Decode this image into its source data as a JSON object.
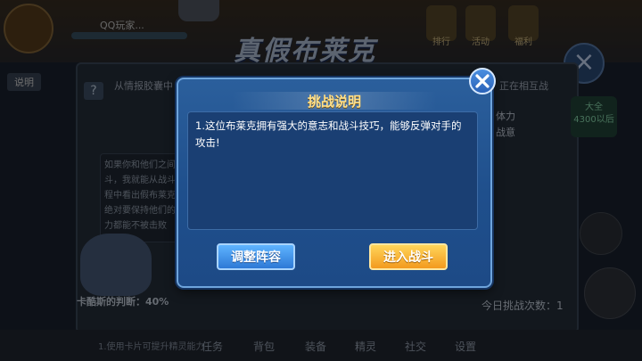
{
  "background": {
    "title": "真假布莱克",
    "player_name": "QQ玩家...",
    "tab_label": "说明",
    "info_text": "从情报胶囊中",
    "info_text_right": "正在相互战",
    "side_labels": [
      "体力",
      "战意"
    ],
    "stat_badge": [
      "大全",
      "4300以后"
    ],
    "description": "如果你和他们之间战斗，我就能从战斗过程中看出假布莱克，绝对要保持他们的体力都能不被击败",
    "odds_label": "卡酷斯的判断：40%",
    "daily_attempts_label": "今日挑战次数：",
    "daily_attempts_value": "1",
    "top_icons": [
      "排行",
      "活动",
      "福利"
    ],
    "bottom_nav": [
      "任务",
      "背包",
      "装备",
      "精灵",
      "社交",
      "设置"
    ],
    "bottom_left_text": "1.使用卡片可提升精灵能力"
  },
  "dialog": {
    "title": "挑战说明",
    "content": "1.这位布莱克拥有强大的意志和战斗技巧，能够反弹对手的攻击!",
    "adjust_button": "调整阵容",
    "enter_button": "进入战斗"
  },
  "colors": {
    "dialog_bg": "#1f4f8c",
    "title_color": "#ffe08a",
    "adjust_button": "#2d79d6",
    "enter_button": "#f39a1e"
  }
}
